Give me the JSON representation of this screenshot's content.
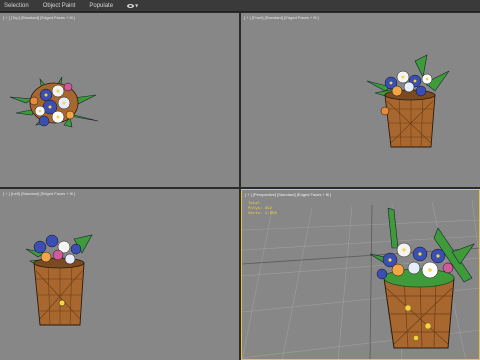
{
  "ribbon": {
    "tabs": [
      "Selection",
      "Object Paint",
      "Populate"
    ]
  },
  "viewports": {
    "top": {
      "label": "[ + ] [Top] [Standard] [Edged Faces + ftl ]"
    },
    "front": {
      "label": "[ + ] [Front] [Standard] [Edged Faces + ftl ]"
    },
    "left": {
      "label": "[ + ] [Left] [Standard] [Edged Faces + ftl ]"
    },
    "perspective": {
      "label": "[ + ] [Perspective] [Standard] [Edged Faces + ftl ]"
    }
  },
  "stats": {
    "total": "Total",
    "polys": "Polys: 892",
    "verts": "Verts: 1,056"
  },
  "colors": {
    "viewport_bg": "#878787",
    "active_border": "#e6c24a",
    "stats_text": "#f2d540",
    "pot_brown": "#a8672f",
    "leaf_green": "#3f9a3a",
    "flower_blue": "#3b4fb3"
  }
}
